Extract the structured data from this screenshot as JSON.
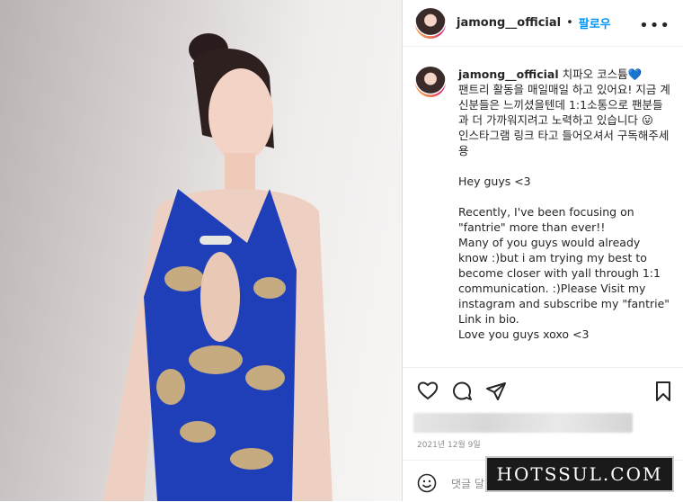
{
  "post": {
    "username": "jamong__official",
    "follow_label": "팔로우",
    "separator": "•",
    "more_label": "•••",
    "caption_user": "jamong__official",
    "caption_text": " 치파오 코스튬💙\n팬트리 활동을 매일매일 하고 있어요! 지금 계신분들은 느끼셨을텐데 1:1소통으로 팬분들과 더 가까워지려고 노력하고 있습니다 😛\n인스타그램 링크 타고 들어오셔서 구독해주세용\n\nHey guys <3\n\nRecently, I've been focusing on \"fantrie\" more than ever!!\nMany of you guys would already know :)but i am trying my best to become closer with yall through 1:1 communication. :)Please Visit my instagram and subscribe my \"fantrie\"\nLink in bio.\nLove you guys xoxo <3",
    "date": "2021년 12월 9일",
    "comment_placeholder": "댓글 달기..."
  },
  "icons": {
    "like": "heart-icon",
    "comment": "comment-icon",
    "share": "send-icon",
    "save": "bookmark-icon",
    "emoji": "smile-icon",
    "more": "more-options-icon"
  },
  "watermark": {
    "text": "HOTSSUL.COM"
  },
  "colors": {
    "follow": "#0095f6",
    "text": "#262626",
    "muted": "#8e8e8e",
    "outfit_blue": "#1f3fb8",
    "outfit_gold": "#d9b77a"
  }
}
